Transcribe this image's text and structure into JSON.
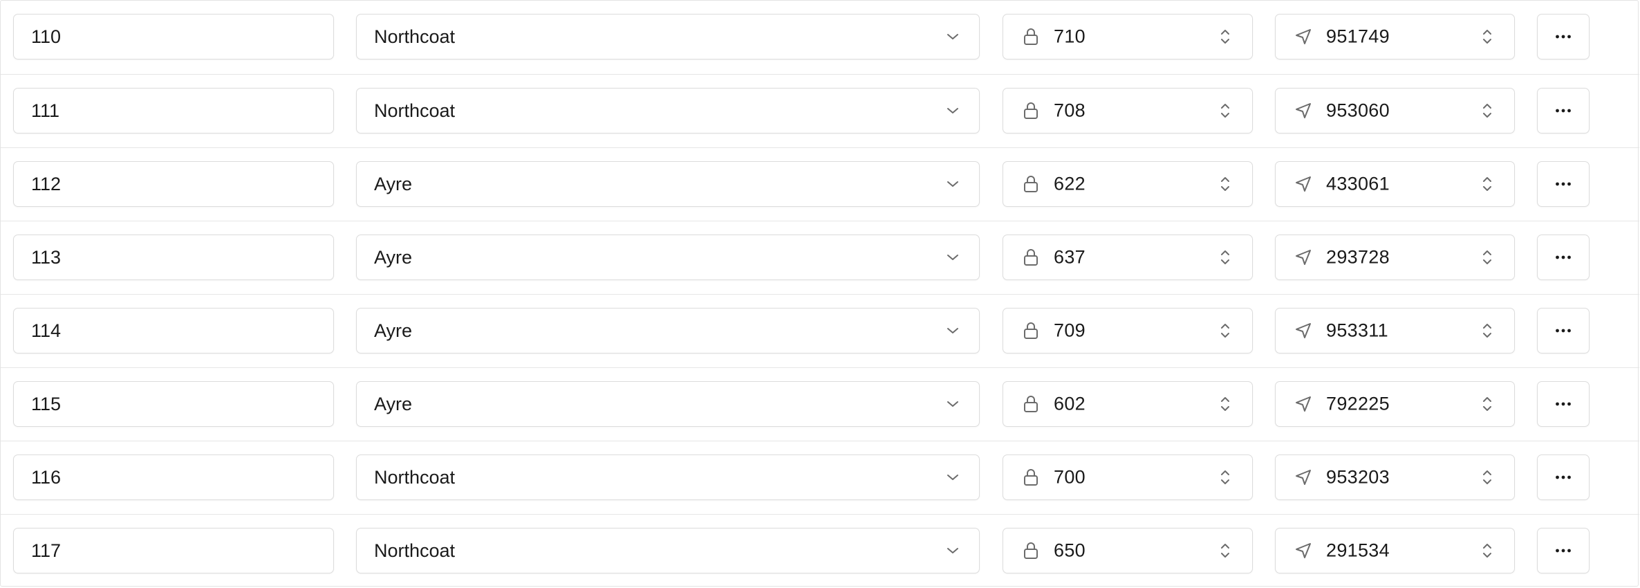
{
  "rows": [
    {
      "id": "110",
      "location": "Northcoat",
      "code": "710",
      "coord": "951749"
    },
    {
      "id": "111",
      "location": "Northcoat",
      "code": "708",
      "coord": "953060"
    },
    {
      "id": "112",
      "location": "Ayre",
      "code": "622",
      "coord": "433061"
    },
    {
      "id": "113",
      "location": "Ayre",
      "code": "637",
      "coord": "293728"
    },
    {
      "id": "114",
      "location": "Ayre",
      "code": "709",
      "coord": "953311"
    },
    {
      "id": "115",
      "location": "Ayre",
      "code": "602",
      "coord": "792225"
    },
    {
      "id": "116",
      "location": "Northcoat",
      "code": "700",
      "coord": "953203"
    },
    {
      "id": "117",
      "location": "Northcoat",
      "code": "650",
      "coord": "291534"
    }
  ],
  "icons": {
    "select": "chevron-down-icon",
    "code": "lock-icon",
    "coord": "navigation-arrow-icon",
    "stepper": "chevron-up-down-icon",
    "more": "more-horizontal-icon"
  },
  "colors": {
    "border": "#dcdcdc",
    "row_divider": "#e6e6e6",
    "icon": "#6b6b6b",
    "text": "#1a1a1a"
  }
}
